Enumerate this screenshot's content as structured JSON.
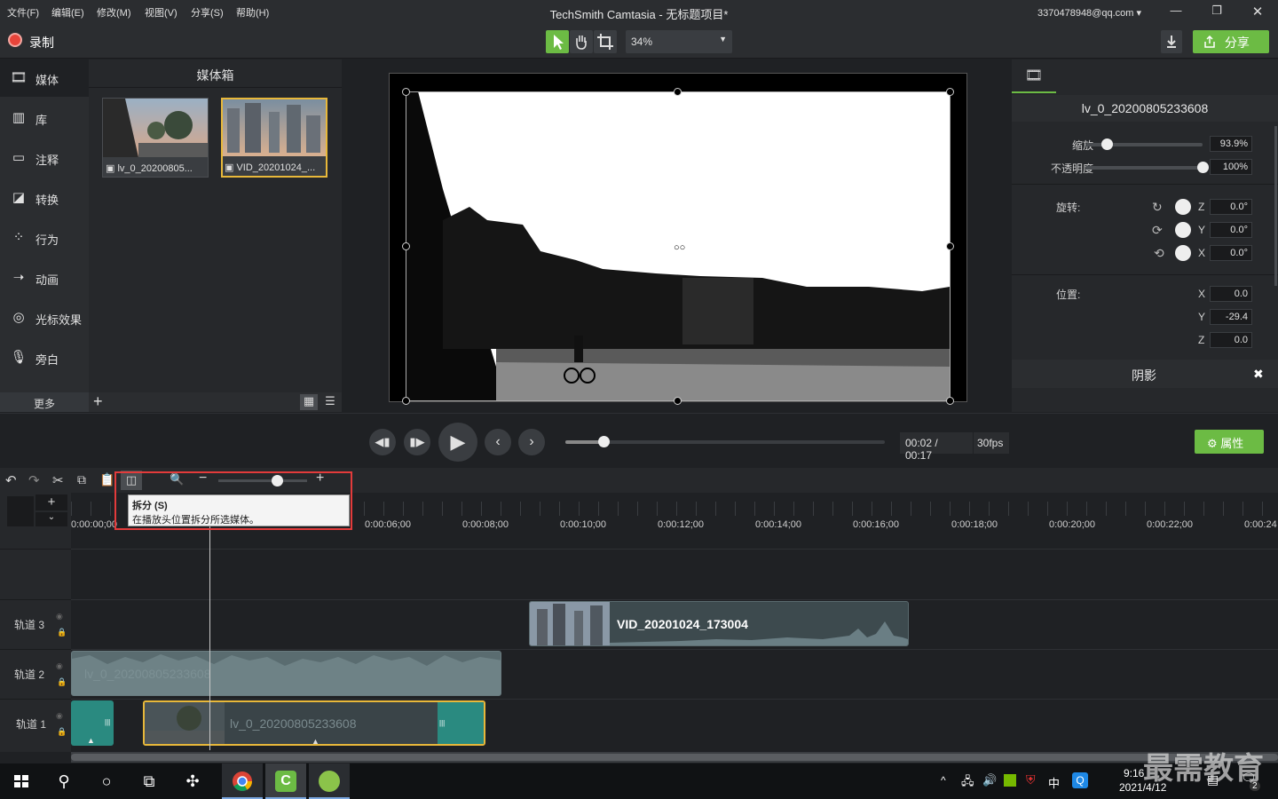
{
  "menu": [
    "文件(F)",
    "编辑(E)",
    "修改(M)",
    "视图(V)",
    "分享(S)",
    "帮助(H)"
  ],
  "app_title": "TechSmith Camtasia - 无标题项目*",
  "account": "3370478948@qq.com",
  "toolbar": {
    "record_label": "录制",
    "zoom_value": "34%",
    "share_label": "分享"
  },
  "nav": {
    "items": [
      "媒体",
      "库",
      "注释",
      "转换",
      "行为",
      "动画",
      "光标效果",
      "旁白"
    ],
    "more_label": "更多"
  },
  "media_bin": {
    "title": "媒体箱",
    "items": [
      "lv_0_20200805...",
      "VID_20201024_..."
    ]
  },
  "properties": {
    "clip_name": "lv_0_20200805233608",
    "scale_label": "缩放",
    "scale_value": "93.9%",
    "scale_level": 0.18,
    "opacity_label": "不透明度",
    "opacity_value": "100%",
    "opacity_level": 1.0,
    "rotation_label": "旋转:",
    "rot_z": "0.0°",
    "rot_y": "0.0°",
    "rot_x": "0.0°",
    "position_label": "位置:",
    "pos_x": "0.0",
    "pos_y": "-29.4",
    "pos_z": "0.0",
    "shadow_label": "阴影",
    "axis": {
      "x": "X",
      "y": "Y",
      "z": "Z"
    }
  },
  "playback": {
    "time": "00:02 / 00:17",
    "fps": "30fps",
    "progress": 0.12,
    "props_button": "属性"
  },
  "tooltip": {
    "title": "拆分 (S)",
    "desc": "在播放头位置拆分所选媒体。"
  },
  "ruler_ticks": [
    "0:00:00;00",
    "0:00:06;00",
    "0:00:08;00",
    "0:00:10;00",
    "0:00:12;00",
    "0:00:14;00",
    "0:00:16;00",
    "0:00:18;00",
    "0:00:20;00",
    "0:00:22;00",
    "0:00:24"
  ],
  "tracks": {
    "t3": "轨道 3",
    "t2": "轨道 2",
    "t1": "轨道 1",
    "clip_t3": "VID_20201024_173004",
    "clip_t2": "lv_0_20200805233608",
    "clip_t1": "lv_0_20200805233608"
  },
  "taskbar": {
    "time": "9:16",
    "date": "2021/4/12",
    "ime": "中",
    "badge": "2"
  },
  "watermark": "最需教育"
}
